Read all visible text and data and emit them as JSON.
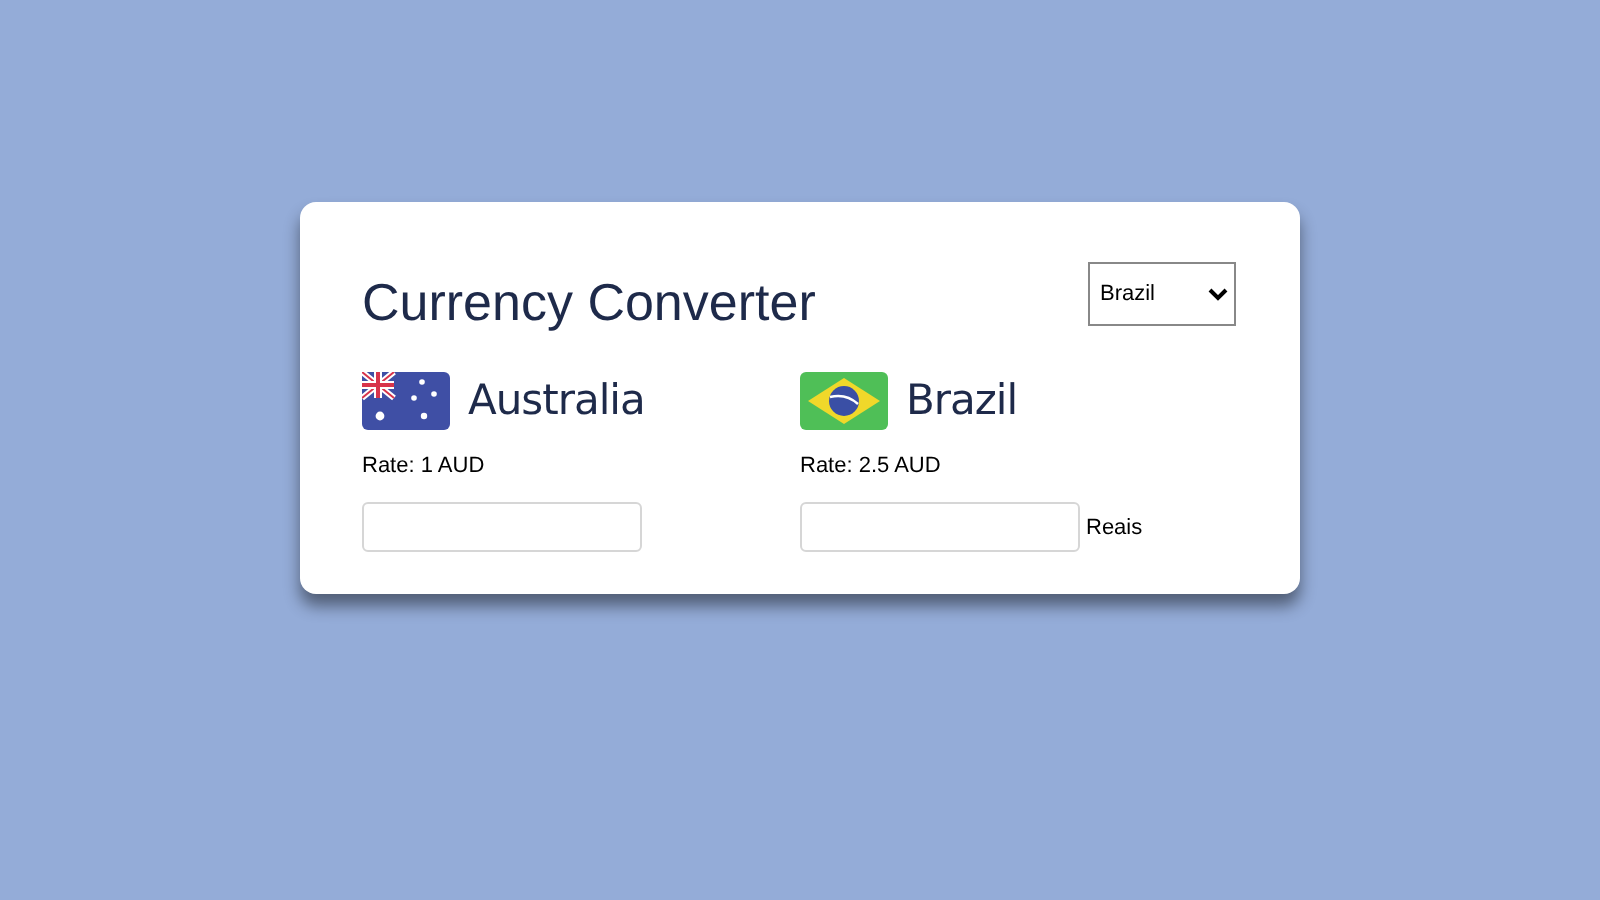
{
  "title": "Currency Converter",
  "currency_select": {
    "value": "Brazil"
  },
  "currencies": [
    {
      "kind": "australia",
      "name": "Australia",
      "rate": "Rate: 1 AUD"
    },
    {
      "kind": "brazil",
      "name": "Brazil",
      "rate": "Rate: 2.5 AUD",
      "unit": "Reais"
    }
  ]
}
